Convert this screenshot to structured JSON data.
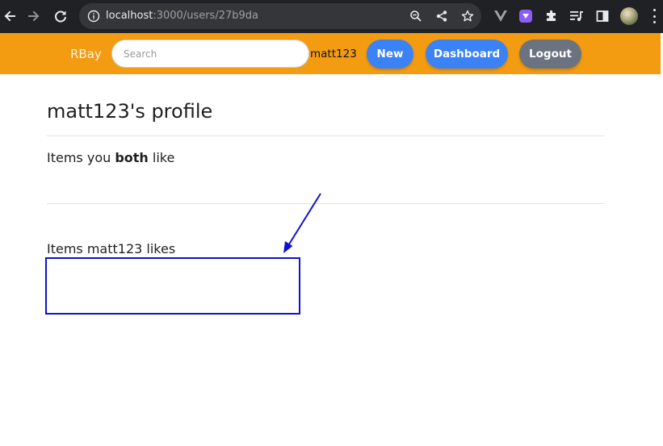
{
  "browser": {
    "url_host": "localhost",
    "url_rest": ":3000/users/27b9da",
    "icons": {
      "back": "arrow-left-icon",
      "forward": "arrow-right-icon",
      "reload": "reload-icon",
      "site_info": "info-icon",
      "zoom": "zoom-icon",
      "share": "share-icon",
      "bookmark": "star-icon",
      "extension_1": "vue-devtools-icon",
      "extension_2": "purple-extension-icon",
      "extensions": "puzzle-icon",
      "media": "media-queue-icon",
      "side_panel": "side-panel-icon",
      "profile": "avatar",
      "menu": "kebab-menu-icon"
    }
  },
  "nav": {
    "brand": "RBay",
    "search_placeholder": "Search",
    "search_value": "",
    "username": "matt123",
    "new_label": "New",
    "dashboard_label": "Dashboard",
    "logout_label": "Logout"
  },
  "profile": {
    "title": "matt123's profile",
    "both_prefix": "Items you ",
    "both_bold": "both",
    "both_suffix": " like",
    "likes_heading": "Items matt123 likes"
  },
  "colors": {
    "chrome_bg": "#202124",
    "omnibox_bg": "#35363a",
    "nav_bg": "#f39c12",
    "primary_button": "#3b82f6",
    "secondary_button": "#6b7280",
    "annotation": "#1010d4"
  }
}
